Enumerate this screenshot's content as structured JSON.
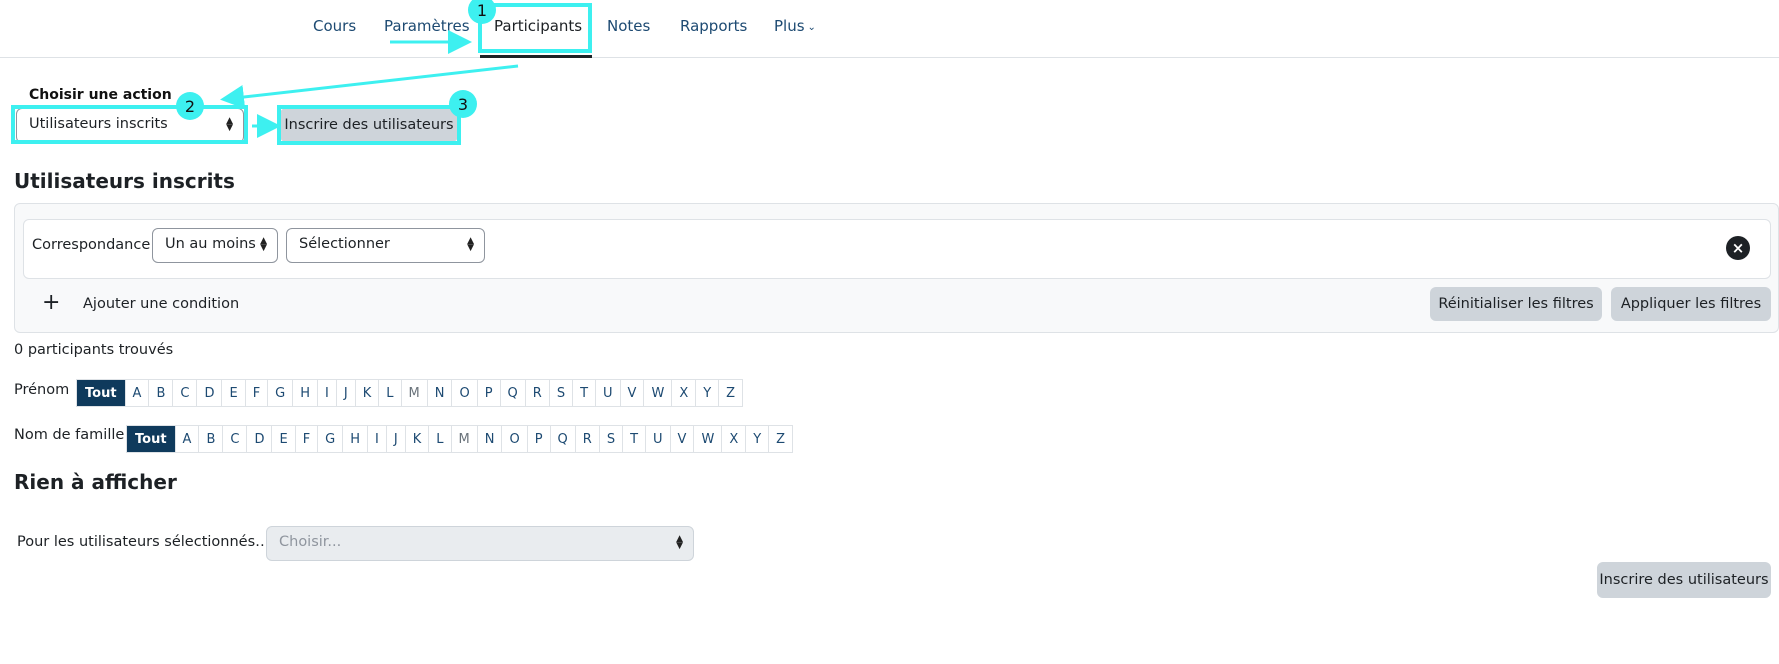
{
  "nav": {
    "items": [
      "Cours",
      "Paramètres",
      "Participants",
      "Notes",
      "Rapports",
      "Plus"
    ],
    "active": "Participants"
  },
  "annotations": {
    "badges": [
      "1",
      "2",
      "3"
    ],
    "highlight_color": "#3df0f0"
  },
  "action": {
    "label": "Choisir une action",
    "select_value": "Utilisateurs inscrits",
    "enrol_button": "Inscrire des utilisateurs"
  },
  "section_title": "Utilisateurs inscrits",
  "filter": {
    "match_label": "Correspondance",
    "match_value": "Un au moins",
    "type_value": "Sélectionner",
    "add_condition": "Ajouter une condition",
    "reset_button": "Réinitialiser les filtres",
    "apply_button": "Appliquer les filtres"
  },
  "count_text": "0 participants trouvés",
  "firstname": {
    "label": "Prénom",
    "all": "Tout",
    "letters": [
      "A",
      "B",
      "C",
      "D",
      "E",
      "F",
      "G",
      "H",
      "I",
      "J",
      "K",
      "L",
      "M",
      "N",
      "O",
      "P",
      "Q",
      "R",
      "S",
      "T",
      "U",
      "V",
      "W",
      "X",
      "Y",
      "Z"
    ]
  },
  "lastname": {
    "label": "Nom de famille",
    "all": "Tout",
    "letters": [
      "A",
      "B",
      "C",
      "D",
      "E",
      "F",
      "G",
      "H",
      "I",
      "J",
      "K",
      "L",
      "M",
      "N",
      "O",
      "P",
      "Q",
      "R",
      "S",
      "T",
      "U",
      "V",
      "W",
      "X",
      "Y",
      "Z"
    ]
  },
  "empty_title": "Rien à afficher",
  "bulk": {
    "label": "Pour les utilisateurs sélectionnés…",
    "placeholder": "Choisir..."
  },
  "bottom_button": "Inscrire des utilisateurs",
  "colors": {
    "primary_dark": "#0f3a5c",
    "button_gray": "#ced4da",
    "accent": "#3df0f0"
  }
}
